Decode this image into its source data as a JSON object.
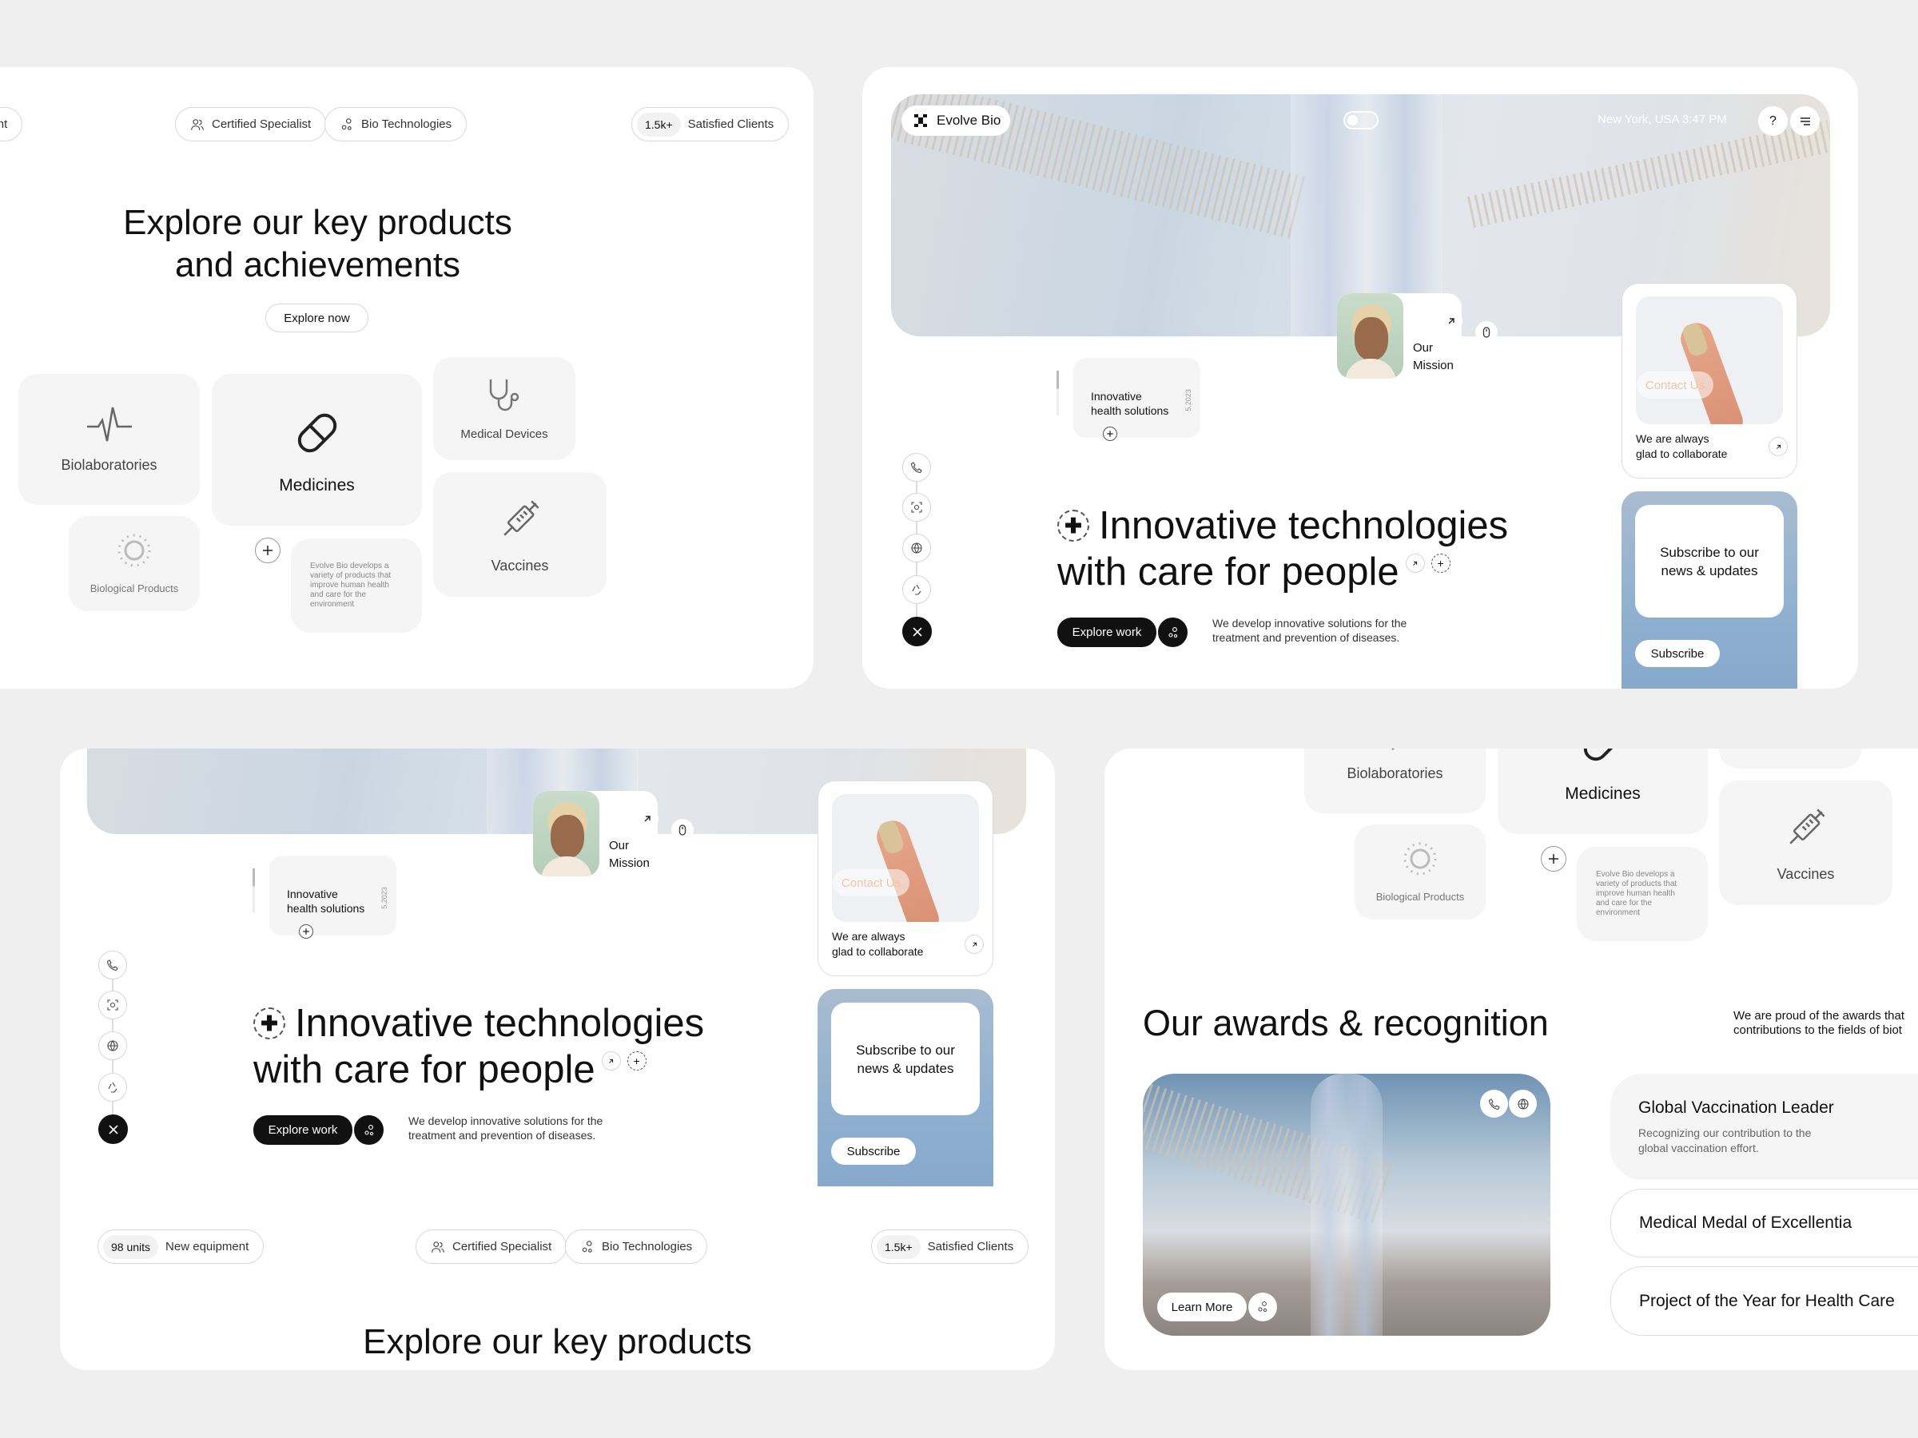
{
  "colors": {
    "background": "#efefef",
    "panel": "#ffffff",
    "tile": "#f5f5f5",
    "dark": "#111111"
  },
  "badges": {
    "new_equipment": {
      "count": "98 units",
      "label": "New equipment",
      "icon": "none"
    },
    "certified": {
      "label": "Certified Specialist",
      "icon": "users-icon"
    },
    "bio_tech": {
      "label": "Bio Technologies",
      "icon": "molecule-icon"
    },
    "clients": {
      "count": "1.5k+",
      "label": "Satisfied Clients"
    }
  },
  "products": {
    "title_line1": "Explore our key products",
    "title_line2": "and achievements",
    "explore_button": "Explore now",
    "tiles": [
      {
        "label": "Biolaboratories",
        "icon": "heartbeat-icon"
      },
      {
        "label": "Medicines",
        "icon": "pill-icon"
      },
      {
        "label": "Medical Devices",
        "icon": "stethoscope-icon"
      },
      {
        "label": "Vaccines",
        "icon": "syringe-icon"
      },
      {
        "label": "Biological Products",
        "icon": "sun-icon"
      }
    ],
    "description": "Evolve Bio develops a variety of products that improve human health and care for the environment"
  },
  "hero": {
    "brand": "Evolve Bio",
    "location_time": "New York, USA 3:47 PM",
    "help_label": "?",
    "mission_line1": "Our",
    "mission_line2": "Mission",
    "health_line1": "Innovative",
    "health_line2": "health solutions",
    "health_date": "5.2023",
    "headline_line1": "Innovative technologies",
    "headline_line2": "with care for people",
    "explore_work": "Explore work",
    "description_line1": "We develop innovative solutions for the",
    "description_line2": "treatment and prevention of diseases.",
    "contact_button": "Contact Us",
    "collab_line1": "We are always",
    "collab_line2": "glad to collaborate",
    "subscribe_line1": "Subscribe to our",
    "subscribe_line2": "news & updates",
    "subscribe_button": "Subscribe",
    "side_icons": [
      "phone-icon",
      "scan-icon",
      "globe-icon",
      "recycle-icon",
      "close-icon"
    ]
  },
  "bottom_products_title": "Explore our key products",
  "awards": {
    "title": "Our awards & recognition",
    "intro_line1": "We are proud of the awards that",
    "intro_line2": "contributions to the fields of biot",
    "learn_more": "Learn More",
    "items": [
      {
        "title": "Global Vaccination Leader",
        "subtitle_line1": "Recognizing our contribution to the",
        "subtitle_line2": "global vaccination effort."
      },
      {
        "title": "Medical Medal of Excellentia"
      },
      {
        "title": "Project of the Year for Health Care"
      }
    ]
  }
}
